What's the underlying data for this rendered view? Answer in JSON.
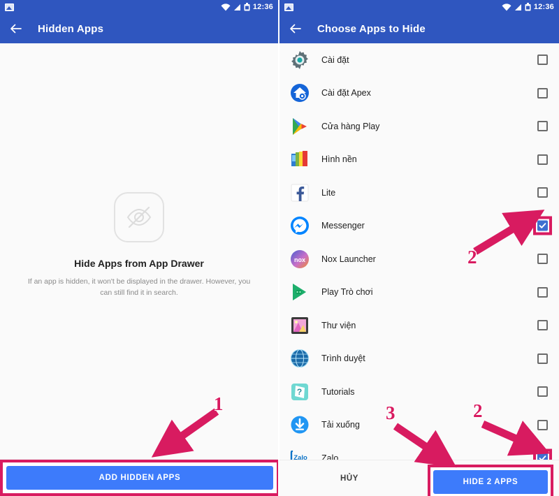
{
  "status_bar": {
    "time": "12:36",
    "icons": [
      "photo-icon",
      "wifi-icon",
      "signal-icon",
      "battery-icon"
    ]
  },
  "colors": {
    "appbar_blue": "#2f56bf",
    "button_blue": "#3d7bfb",
    "checkbox_blue": "#3d6fd0",
    "annotation_crimson": "#d81b60",
    "background": "#fafafa"
  },
  "left_screen": {
    "title": "Hidden Apps",
    "back_icon": "back-arrow-icon",
    "empty_state": {
      "icon": "eye-off-icon",
      "title": "Hide Apps from App Drawer",
      "description": "If an app is hidden, it won't be displayed in the drawer. However, you can still find it in search."
    },
    "primary_button": "ADD HIDDEN APPS",
    "annotation": "1"
  },
  "right_screen": {
    "title": "Choose Apps to Hide",
    "back_icon": "back-arrow-icon",
    "apps": [
      {
        "name": "Cài đặt",
        "icon": "settings-gear-icon",
        "checked": false,
        "highlighted": false
      },
      {
        "name": "Cài đặt Apex",
        "icon": "apex-settings-icon",
        "checked": false,
        "highlighted": false
      },
      {
        "name": "Cửa hàng Play",
        "icon": "play-store-icon",
        "checked": false,
        "highlighted": false
      },
      {
        "name": "Hình nền",
        "icon": "wallpaper-icon",
        "checked": false,
        "highlighted": false
      },
      {
        "name": "Lite",
        "icon": "facebook-lite-icon",
        "checked": false,
        "highlighted": false
      },
      {
        "name": "Messenger",
        "icon": "messenger-icon",
        "checked": true,
        "highlighted": true
      },
      {
        "name": "Nox Launcher",
        "icon": "nox-launcher-icon",
        "checked": false,
        "highlighted": false
      },
      {
        "name": "Play Trò chơi",
        "icon": "play-games-icon",
        "checked": false,
        "highlighted": false
      },
      {
        "name": "Thư viện",
        "icon": "gallery-icon",
        "checked": false,
        "highlighted": false
      },
      {
        "name": "Trình duyệt",
        "icon": "browser-globe-icon",
        "checked": false,
        "highlighted": false
      },
      {
        "name": "Tutorials",
        "icon": "tutorials-icon",
        "checked": false,
        "highlighted": false
      },
      {
        "name": "Tải xuống",
        "icon": "downloads-icon",
        "checked": false,
        "highlighted": false
      },
      {
        "name": "Zalo",
        "icon": "zalo-icon",
        "checked": true,
        "highlighted": true
      }
    ],
    "cancel_button": "HỦY",
    "confirm_button": "HIDE 2 APPS",
    "annotations": {
      "checkbox_messenger": "2",
      "checkbox_zalo": "2",
      "confirm_button": "3"
    }
  }
}
